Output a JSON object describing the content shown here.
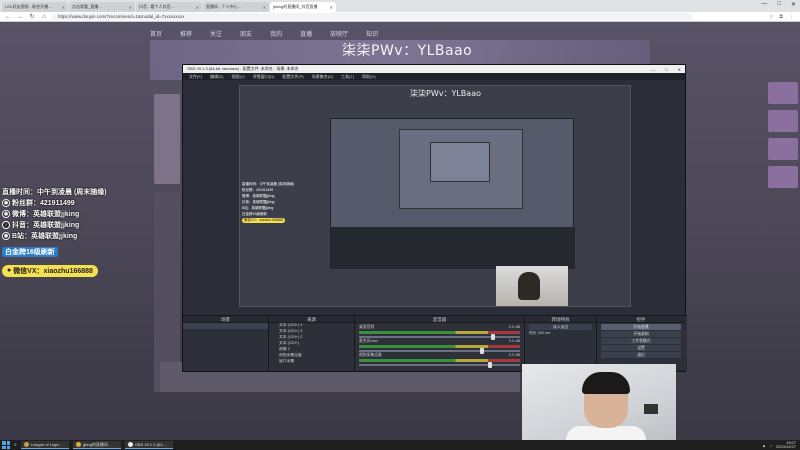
{
  "browser": {
    "tabs": [
      {
        "label": "LOL好友视频 - 联合开播..."
      },
      {
        "label": "点击观看_直播..."
      },
      {
        "label": "抖音 - 看个人抖音..."
      },
      {
        "label": "直播间 - 个人中心..."
      },
      {
        "label": "jkking的直播间_抖音直播"
      }
    ],
    "url": "https://www.douyin.com/?recommend=1&modal_id=7xxxxxxxxx",
    "window_controls": [
      "—",
      "□",
      "✕"
    ]
  },
  "page": {
    "nav": [
      "首页",
      "推荐",
      "关注",
      "朋友",
      "我的",
      "直播",
      "放映厅",
      "知识"
    ],
    "stream_title": "柒柒PWv：YLBaao"
  },
  "info_overlay": {
    "schedule": "直播时间：中午到凌晨 (周末随缘)",
    "fan_group": "粉丝群：421911499",
    "weibo": "微博：英雄联盟jjking",
    "douyin": "抖音：英雄联盟jjking",
    "bilibili": "B站：英雄联盟jjking",
    "tag": "白金跨16级刷新",
    "wechat": "微信VX：xiaozhu166888"
  },
  "obs": {
    "window_title": "OBS 29.1.3 (64-bit, windows) - 配置文件: 未命名 - 场景: 未命名",
    "menu": [
      "文件(F)",
      "编辑(E)",
      "视图(V)",
      "停靠窗口(D)",
      "配置文件(P)",
      "场景集合(S)",
      "工具(T)",
      "帮助(H)"
    ],
    "preview_title": "柒柒PWv：YLBaao",
    "docks": {
      "scenes": "场景",
      "sources": "来源",
      "mixer": "混音器",
      "transitions": "转场特效",
      "controls": "控件"
    },
    "sources": [
      "文本 (GDI+) 4",
      "文本 (GDI+) 3",
      "文本 (GDI+) 2",
      "文本 (GDI+)",
      "图像 2",
      "视频采集设备",
      "窗口采集"
    ],
    "mixer": [
      {
        "name": "桌面音频",
        "level": "0.0 dB",
        "fader": 0.82
      },
      {
        "name": "麦克风/Aux",
        "level": "0.0 dB",
        "fader": 0.75
      },
      {
        "name": "视频采集设备",
        "level": "0.0 dB",
        "fader": 0.8
      }
    ],
    "transition": {
      "type": "淡入淡出",
      "duration_label": "时长",
      "duration": "300 ms"
    },
    "controls": [
      "开始直播",
      "开始录制",
      "工作室模式",
      "设置",
      "退出"
    ]
  },
  "taskbar": {
    "items": [
      {
        "label": "League of Lege..."
      },
      {
        "label": "jjking的直播间..."
      },
      {
        "label": "OBS 29.1.3 (64-..."
      }
    ],
    "time": "19:07",
    "date": "2023/12/27"
  },
  "colors": {
    "accent": "#f5e050",
    "obs_bg": "#2b2e38",
    "page_bg": "#585366"
  }
}
